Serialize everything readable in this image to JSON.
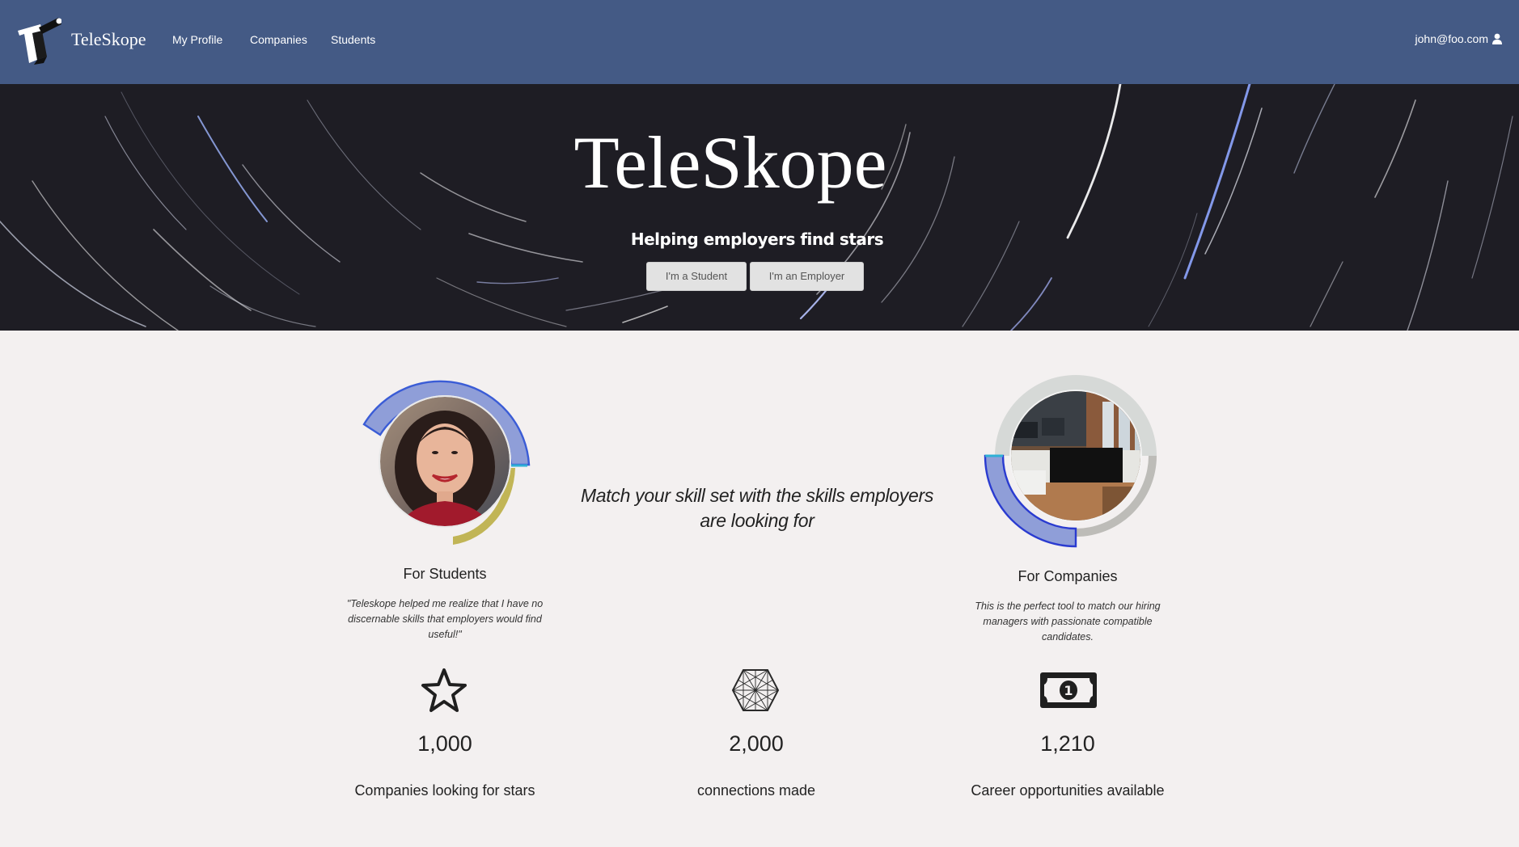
{
  "nav": {
    "brand": "TeleSkope",
    "links": [
      "My Profile",
      "Companies",
      "Students"
    ],
    "user_email": "john@foo.com",
    "user_icon": "user-icon"
  },
  "hero": {
    "title": "TeleSkope",
    "subtitle": "Helping employers find stars",
    "student_button": "I'm a Student",
    "employer_button": "I'm an Employer"
  },
  "features": {
    "students": {
      "title": "For Students",
      "quote": "\"Teleskope helped me realize that I have no discernable skills that employers would find useful!\""
    },
    "tagline": "Match your skill set with the skills employers are looking for",
    "companies": {
      "title": "For Companies",
      "quote": "This is the perfect tool to match our hiring managers with passionate compatible candidates."
    }
  },
  "stats": [
    {
      "icon": "star-icon",
      "value": "1,000",
      "label": "Companies looking for stars"
    },
    {
      "icon": "network-icon",
      "value": "2,000",
      "label": "connections made"
    },
    {
      "icon": "money-icon",
      "value": "1,210",
      "label": "Career opportunities available"
    }
  ],
  "colors": {
    "navbar": "#445a85",
    "hero_bg": "#1e1d24",
    "page_bg": "#f3f0f0",
    "ring_blue": "#8f9ed8",
    "ring_olive": "#c1b556",
    "ring_gray": "#bdbcb8"
  }
}
